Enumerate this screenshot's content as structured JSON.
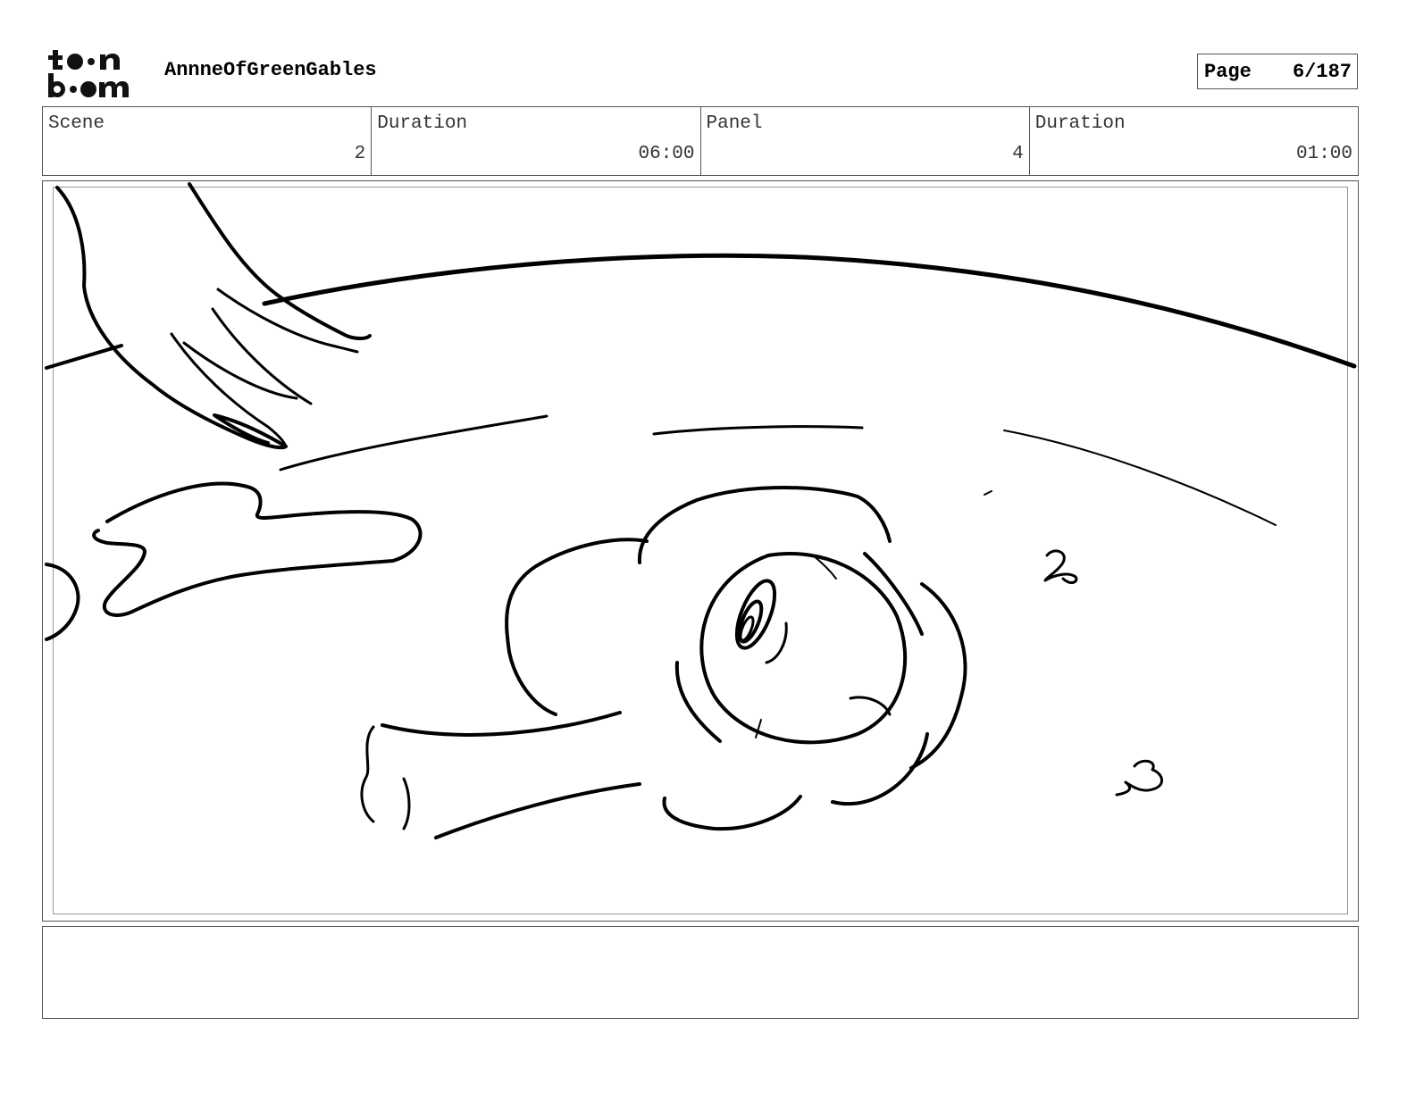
{
  "header": {
    "logo_text": "toon boom",
    "project_title": "AnnneOfGreenGables",
    "page_label": "Page",
    "page_value": "6/187"
  },
  "info": {
    "scene_label": "Scene",
    "scene_value": "2",
    "scene_duration_label": "Duration",
    "scene_duration_value": "06:00",
    "panel_label": "Panel",
    "panel_value": "4",
    "panel_duration_label": "Duration",
    "panel_duration_value": "01:00"
  },
  "notes": {
    "text": ""
  }
}
